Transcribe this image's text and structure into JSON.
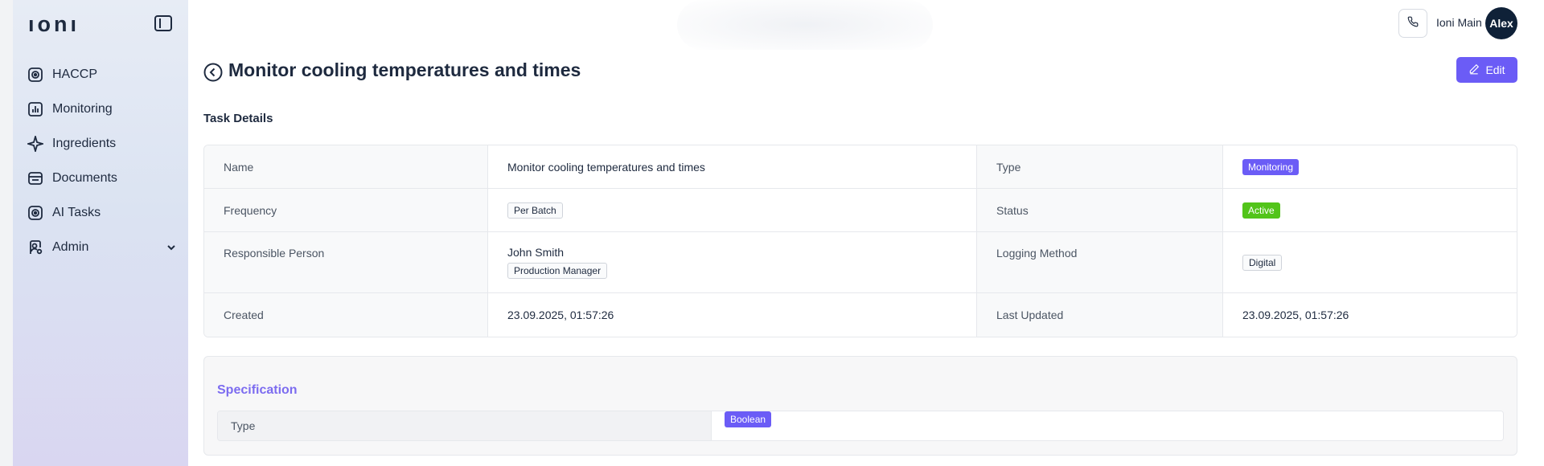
{
  "app": {
    "logo": "ıonı"
  },
  "sidebar": {
    "items": [
      {
        "label": "HACCP",
        "icon": "haccp-icon"
      },
      {
        "label": "Monitoring",
        "icon": "monitoring-icon"
      },
      {
        "label": "Ingredients",
        "icon": "sparkle-icon"
      },
      {
        "label": "Documents",
        "icon": "documents-icon"
      },
      {
        "label": "AI Tasks",
        "icon": "ai-tasks-icon"
      },
      {
        "label": "Admin",
        "icon": "admin-icon",
        "has_submenu": true
      }
    ]
  },
  "header": {
    "account_name": "Ioni Main",
    "avatar_text": "Alex"
  },
  "page": {
    "title": "Monitor cooling temperatures and times",
    "edit_label": "Edit",
    "section_title": "Task Details"
  },
  "details": {
    "name_label": "Name",
    "name_value": "Monitor cooling temperatures and times",
    "type_label": "Type",
    "type_value": "Monitoring",
    "frequency_label": "Frequency",
    "frequency_value": "Per Batch",
    "status_label": "Status",
    "status_value": "Active",
    "responsible_label": "Responsible Person",
    "responsible_name": "John Smith",
    "responsible_role": "Production Manager",
    "logging_label": "Logging Method",
    "logging_value": "Digital",
    "created_label": "Created",
    "created_value": "23.09.2025, 01:57:26",
    "updated_label": "Last Updated",
    "updated_value": "23.09.2025, 01:57:26"
  },
  "specification": {
    "title": "Specification",
    "type_label": "Type",
    "type_value": "Boolean"
  },
  "colors": {
    "accent": "#6b5cf6",
    "status_active": "#52c41a",
    "sidebar_top": "#e7ecf5",
    "sidebar_bottom": "#d9d6f1",
    "text_dark": "#1e2a3f"
  }
}
